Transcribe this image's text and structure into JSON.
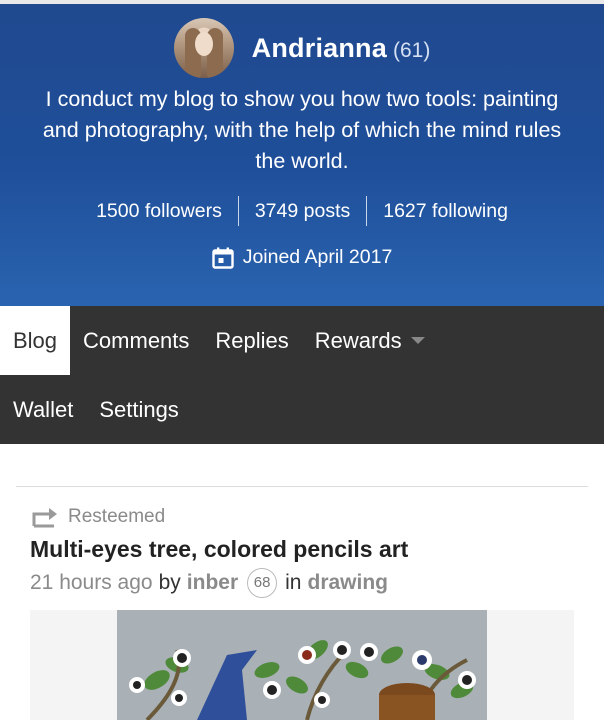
{
  "profile": {
    "name": "Andrianna",
    "reputation": "(61)",
    "bio": "I conduct my blog to show you how two tools: painting and photography, with the help of which the mind rules the world.",
    "followers": "1500 followers",
    "posts": "3749 posts",
    "following": "1627 following",
    "joined": "Joined April 2017",
    "calendar_icon": "calendar-icon"
  },
  "nav": {
    "tabs": [
      {
        "label": "Blog",
        "active": true
      },
      {
        "label": "Comments"
      },
      {
        "label": "Replies"
      },
      {
        "label": "Rewards",
        "dropdown": true
      },
      {
        "label": "Wallet"
      },
      {
        "label": "Settings"
      }
    ]
  },
  "post": {
    "resteem_label": "Resteemed",
    "title": "Multi-eyes tree, colored pencils art",
    "time": "21 hours ago",
    "by_label": "by",
    "author": "inber",
    "author_rep": "68",
    "in_label": "in",
    "category": "drawing"
  },
  "colors": {
    "header_bg": "#1f4f9a",
    "nav_bg": "#333333",
    "active_tab_bg": "#ffffff"
  }
}
